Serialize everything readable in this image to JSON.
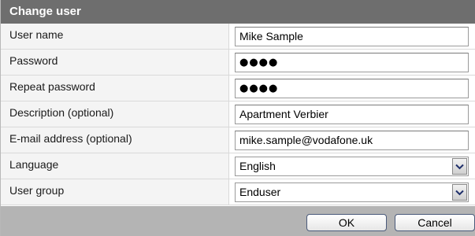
{
  "header": {
    "title": "Change user"
  },
  "form": {
    "fields": [
      {
        "label": "User name",
        "type": "text",
        "value": "Mike Sample"
      },
      {
        "label": "Password",
        "type": "password",
        "value": "●●●●"
      },
      {
        "label": "Repeat password",
        "type": "password",
        "value": "●●●●"
      },
      {
        "label": "Description (optional)",
        "type": "text",
        "value": "Apartment Verbier"
      },
      {
        "label": "E-mail address (optional)",
        "type": "text",
        "value": "mike.sample@vodafone.uk"
      },
      {
        "label": "Language",
        "type": "select",
        "value": "English"
      },
      {
        "label": "User group",
        "type": "select",
        "value": "Enduser"
      }
    ]
  },
  "footer": {
    "ok_label": "OK",
    "cancel_label": "Cancel"
  },
  "icons": {
    "dropdown": "chevron-down-icon"
  },
  "colors": {
    "header_bg": "#6e6e6e",
    "footer_bg": "#b4b4b4",
    "label_bg": "#f4f4f4"
  }
}
